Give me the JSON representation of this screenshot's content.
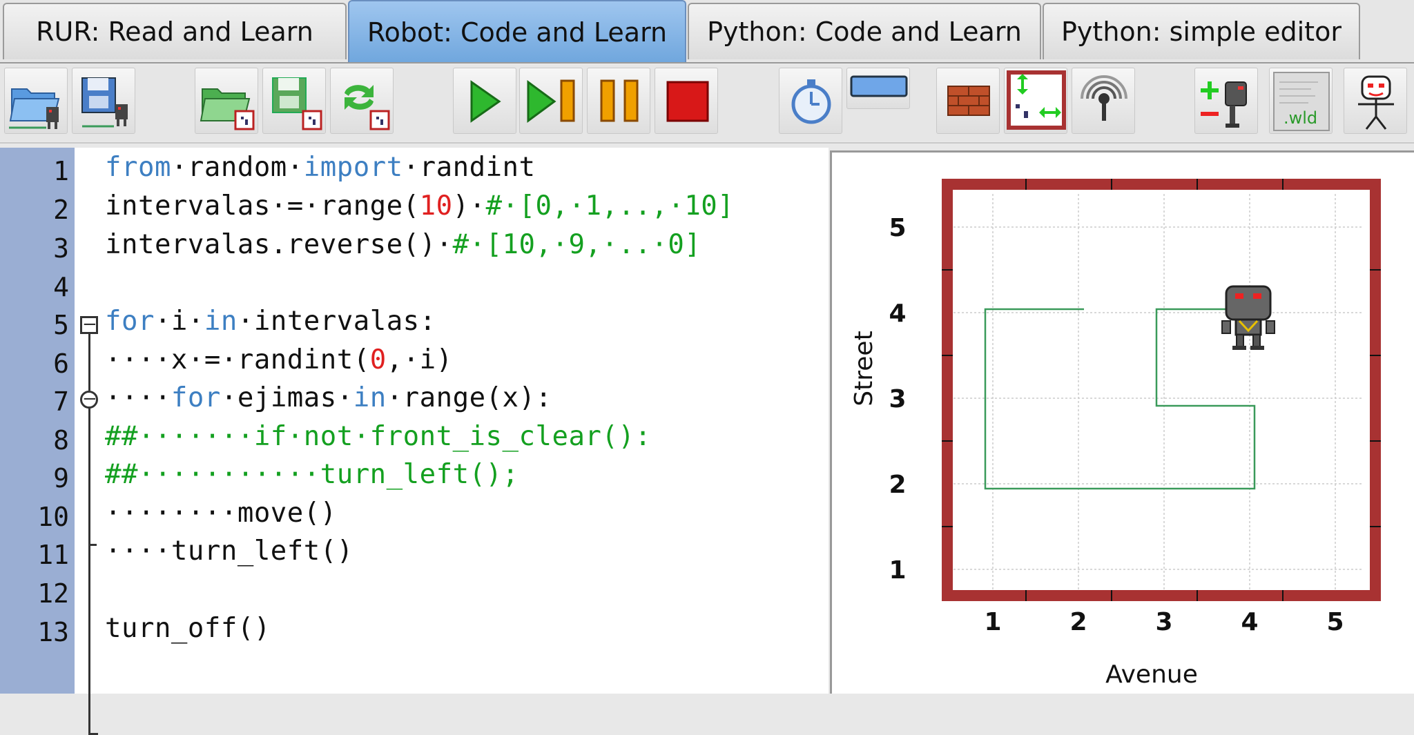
{
  "tabs": [
    {
      "label": "RUR: Read and Learn",
      "active": false
    },
    {
      "label": "Robot: Code and Learn",
      "active": true
    },
    {
      "label": "Python: Code and Learn",
      "active": false
    },
    {
      "label": "Python: simple editor",
      "active": false
    }
  ],
  "toolbar": {
    "buttons": [
      "open-program-icon",
      "save-program-icon",
      "open-world-icon",
      "save-world-icon",
      "reload-world-icon",
      "run-icon",
      "step-icon",
      "pause-icon",
      "stop-icon",
      "speed-timer-icon",
      "robot-world-icon",
      "wall-icon",
      "resize-world-icon",
      "beeper-icon",
      "robot-add-remove-icon",
      "world-file-icon",
      "robot-face-icon"
    ],
    "world_file_label": ".wld"
  },
  "editor": {
    "line_numbers": [
      "1",
      "2",
      "3",
      "4",
      "5",
      "6",
      "7",
      "8",
      "9",
      "10",
      "11",
      "12",
      "13"
    ]
  },
  "world": {
    "x_axis_label": "Avenue",
    "y_axis_label": "Street",
    "x_ticks": [
      "1",
      "2",
      "3",
      "4",
      "5"
    ],
    "y_ticks": [
      "1",
      "2",
      "3",
      "4",
      "5"
    ],
    "robot_avenue": 4,
    "robot_street": 4,
    "trace_color": "#3a9a5a",
    "wall_color": "#a83232"
  }
}
